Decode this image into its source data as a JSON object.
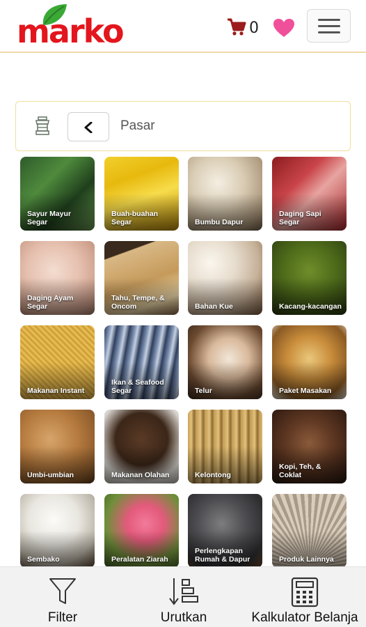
{
  "header": {
    "logo_text": "marko",
    "cart_count": "0",
    "brand_color": "#e3161d",
    "leaf_color": "#3aa935",
    "heart_color": "#f0509a"
  },
  "breadcrumb": {
    "label": "Pasar"
  },
  "categories": [
    {
      "label": "Sayur Mayur Segar",
      "icon": "vegetables"
    },
    {
      "label": "Buah-buahan Segar",
      "icon": "bananas"
    },
    {
      "label": "Bumbu Dapur",
      "icon": "garlic"
    },
    {
      "label": "Daging Sapi Segar",
      "icon": "beef"
    },
    {
      "label": "Daging Ayam Segar",
      "icon": "chicken"
    },
    {
      "label": "Tahu, Tempe, & Oncom",
      "icon": "tofu"
    },
    {
      "label": "Bahan Kue",
      "icon": "baking-ingredients"
    },
    {
      "label": "Kacang-kacangan",
      "icon": "beans"
    },
    {
      "label": "Makanan Instant",
      "icon": "noodles"
    },
    {
      "label": "Ikan & Seafood Segar",
      "icon": "fish"
    },
    {
      "label": "Telur",
      "icon": "eggs"
    },
    {
      "label": "Paket Masakan",
      "icon": "dishes"
    },
    {
      "label": "Umbi-umbian",
      "icon": "tubers"
    },
    {
      "label": "Makanan Olahan",
      "icon": "jerky"
    },
    {
      "label": "Kelontong",
      "icon": "brooms"
    },
    {
      "label": "Kopi, Teh, & Coklat",
      "icon": "coffee-beans"
    },
    {
      "label": "Sembako",
      "icon": "rice"
    },
    {
      "label": "Peralatan Ziarah",
      "icon": "flowers"
    },
    {
      "label": "Perlengkapan Rumah & Dapur",
      "icon": "kitchenware"
    },
    {
      "label": "Produk Lainnya",
      "icon": "fan"
    }
  ],
  "bottom_bar": {
    "filter_label": "Filter",
    "sort_label": "Urutkan",
    "calculator_label": "Kalkulator Belanja"
  }
}
